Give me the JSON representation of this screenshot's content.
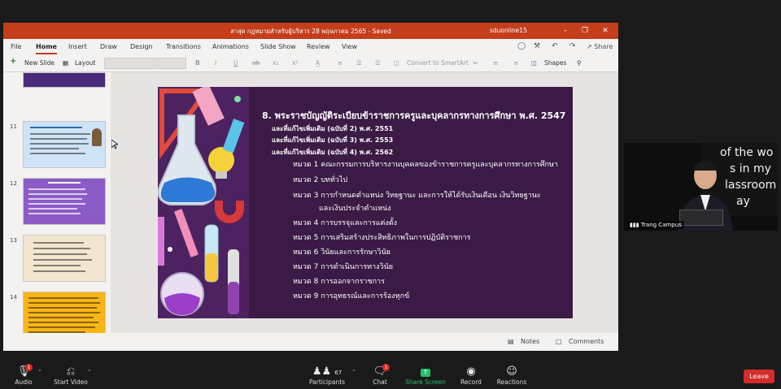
{
  "window": {
    "title": "สาสุด กฎหมายสำหรับผู้บริหาร 28 พฤษภาคม 2565  - Saved",
    "user": "sduonline15"
  },
  "tabs": [
    "File",
    "Home",
    "Insert",
    "Draw",
    "Design",
    "Transitions",
    "Animations",
    "Slide Show",
    "Review",
    "View"
  ],
  "tabs_right": {
    "share": "Share"
  },
  "ribbon": {
    "new_slide": "New Slide",
    "layout": "Layout",
    "bold": "B",
    "italic": "I",
    "underline": "U",
    "strike": "ab",
    "subscript": "x₂",
    "superscript": "x²",
    "convert": "Convert to SmartArt",
    "shapes": "Shapes"
  },
  "thumbnails": [
    {
      "num": "11",
      "bg": "#cfe3f6"
    },
    {
      "num": "12",
      "bg": "#8b5bc7"
    },
    {
      "num": "13",
      "bg": "#f2e6d0"
    },
    {
      "num": "14",
      "bg": "#f7b516"
    },
    {
      "num": "15",
      "bg": "#ffffff"
    }
  ],
  "slide": {
    "heading": "8. พระราชบัญญัติระเบียบข้าราชการครูและบุคลากรทางการศึกษา พ.ศ. 2547",
    "amendments": [
      "และที่แก้ไขเพิ่มเติม (ฉบับที่ 2) พ.ศ. 2551",
      "และที่แก้ไขเพิ่มเติม (ฉบับที่ 3) พ.ศ. 2553",
      "และที่แก้ไขเพิ่มเติม (ฉบับที่ 4) พ.ศ. 2562"
    ],
    "chapters": [
      "หมวด 1 คณะกรรมการบริหารงานบุคคลของข้าราชการครูและบุคลากรทางการศึกษา",
      "หมวด 2 บททั่วไป",
      "หมวด 3 การกำหนดตำแหน่ง วิทยฐานะ และการให้ได้รับเงินเดือน เงินวิทยฐานะ",
      "และเงินประจำตำแหน่ง",
      "หมวด 4 การบรรจุและการแต่งตั้ง",
      "หมวด 5 การเสริมสร้างประสิทธิภาพในการปฏิบัติราชการ",
      "หมวด 6 วินัยและการรักษาวินัย",
      "หมวด 7 การดำเนินการทางวินัย",
      "หมวด 8 การออกจากราชการ",
      "หมวด 9 การอุทธรณ์และการร้องทุกข์"
    ]
  },
  "statusbar": {
    "notes": "Notes",
    "comments": "Comments"
  },
  "video": {
    "board_lines": [
      "of the wo",
      "s in my",
      "lassroom",
      "ay"
    ],
    "name": "Trang Campus"
  },
  "zoom": {
    "audio": "Audio",
    "start_video": "Start Video",
    "participants": "Participants",
    "participants_count": "67",
    "chat": "Chat",
    "chat_badge": "1",
    "audio_badge": "1",
    "share_screen": "Share Screen",
    "record": "Record",
    "reactions": "Reactions",
    "leave": "Leave"
  }
}
